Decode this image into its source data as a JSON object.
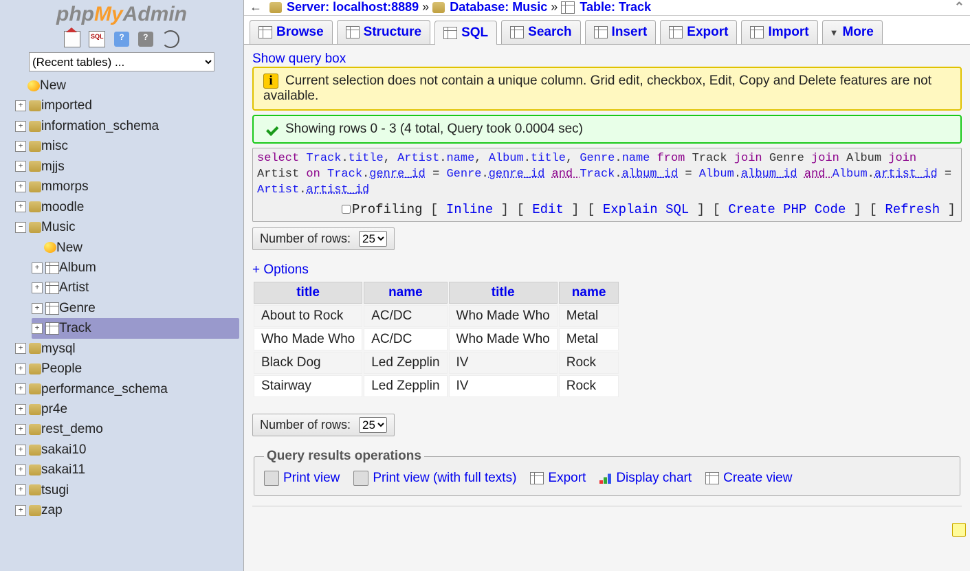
{
  "logo": {
    "php": "php",
    "my": "My",
    "admin": "Admin"
  },
  "sidebar": {
    "recent_placeholder": "(Recent tables) ...",
    "toolbar": [
      "home",
      "sql",
      "help",
      "talk",
      "reload"
    ],
    "new_label": "New",
    "dbs": [
      {
        "name": "imported",
        "expanded": false
      },
      {
        "name": "information_schema",
        "expanded": false
      },
      {
        "name": "misc",
        "expanded": false
      },
      {
        "name": "mjjs",
        "expanded": false
      },
      {
        "name": "mmorps",
        "expanded": false
      },
      {
        "name": "moodle",
        "expanded": false
      },
      {
        "name": "Music",
        "expanded": true,
        "tables": [
          {
            "name": "New",
            "new": true
          },
          {
            "name": "Album"
          },
          {
            "name": "Artist"
          },
          {
            "name": "Genre"
          },
          {
            "name": "Track",
            "selected": true
          }
        ]
      },
      {
        "name": "mysql",
        "expanded": false
      },
      {
        "name": "People",
        "expanded": false
      },
      {
        "name": "performance_schema",
        "expanded": false
      },
      {
        "name": "pr4e",
        "expanded": false
      },
      {
        "name": "rest_demo",
        "expanded": false
      },
      {
        "name": "sakai10",
        "expanded": false
      },
      {
        "name": "sakai11",
        "expanded": false
      },
      {
        "name": "tsugi",
        "expanded": false
      },
      {
        "name": "zap",
        "expanded": false
      }
    ]
  },
  "breadcrumb": {
    "server_label": "Server:",
    "server_value": "localhost:8889",
    "db_label": "Database:",
    "db_value": "Music",
    "table_label": "Table:",
    "table_value": "Track"
  },
  "tabs": [
    {
      "label": "Browse"
    },
    {
      "label": "Structure"
    },
    {
      "label": "SQL",
      "active": true
    },
    {
      "label": "Search"
    },
    {
      "label": "Insert"
    },
    {
      "label": "Export"
    },
    {
      "label": "Import"
    },
    {
      "label": "More",
      "chev": true
    }
  ],
  "show_query_box": "Show query box",
  "warning_text": "Current selection does not contain a unique column. Grid edit, checkbox, Edit, Copy and Delete features are not available.",
  "ok_text": "Showing rows 0 - 3 (4 total, Query took 0.0004 sec)",
  "sql_tokens": [
    {
      "t": "select ",
      "c": "kw"
    },
    {
      "t": "Track",
      "c": "id"
    },
    {
      "t": "."
    },
    {
      "t": "title",
      "c": "id"
    },
    {
      "t": ", "
    },
    {
      "t": "Artist",
      "c": "id"
    },
    {
      "t": "."
    },
    {
      "t": "name",
      "c": "id"
    },
    {
      "t": ", "
    },
    {
      "t": "Album",
      "c": "id"
    },
    {
      "t": "."
    },
    {
      "t": "title",
      "c": "id"
    },
    {
      "t": ", "
    },
    {
      "t": "Genre",
      "c": "id"
    },
    {
      "t": "."
    },
    {
      "t": "name",
      "c": "id"
    },
    {
      "t": " "
    },
    {
      "t": "from ",
      "c": "kw"
    },
    {
      "t": "Track "
    },
    {
      "t": "join ",
      "c": "kw"
    },
    {
      "t": "Genre "
    },
    {
      "t": "join ",
      "c": "kw"
    },
    {
      "t": "Album "
    },
    {
      "t": "join ",
      "c": "kw"
    },
    {
      "t": "Artist "
    },
    {
      "t": "on ",
      "c": "kw"
    },
    {
      "t": "Track",
      "c": "id"
    },
    {
      "t": "."
    },
    {
      "t": "genre_id",
      "c": "id underline"
    },
    {
      "t": " = "
    },
    {
      "t": "Genre",
      "c": "id"
    },
    {
      "t": "."
    },
    {
      "t": "genre_id",
      "c": "id underline"
    },
    {
      "t": " "
    },
    {
      "t": "and ",
      "c": "kw underline"
    },
    {
      "t": "Track",
      "c": "id"
    },
    {
      "t": "."
    },
    {
      "t": "album_id",
      "c": "id underline"
    },
    {
      "t": " = "
    },
    {
      "t": "Album",
      "c": "id"
    },
    {
      "t": "."
    },
    {
      "t": "album_id",
      "c": "id underline"
    },
    {
      "t": " "
    },
    {
      "t": "and ",
      "c": "kw underline"
    },
    {
      "t": "Album",
      "c": "id"
    },
    {
      "t": "."
    },
    {
      "t": "artist_id",
      "c": "id underline"
    },
    {
      "t": " = "
    },
    {
      "t": "Artist",
      "c": "id"
    },
    {
      "t": "."
    },
    {
      "t": "artist_id",
      "c": "id underline"
    }
  ],
  "sql_actions": {
    "profiling": "Profiling",
    "inline": "Inline",
    "edit": "Edit",
    "explain": "Explain SQL",
    "php": "Create PHP Code",
    "refresh": "Refresh"
  },
  "rows_label": "Number of rows:",
  "rows_value": "25",
  "options_link": "+ Options",
  "table": {
    "headers": [
      "title",
      "name",
      "title",
      "name"
    ],
    "rows": [
      [
        "About to Rock",
        "AC/DC",
        "Who Made Who",
        "Metal"
      ],
      [
        "Who Made Who",
        "AC/DC",
        "Who Made Who",
        "Metal"
      ],
      [
        "Black Dog",
        "Led Zepplin",
        "IV",
        "Rock"
      ],
      [
        "Stairway",
        "Led Zepplin",
        "IV",
        "Rock"
      ]
    ]
  },
  "ops": {
    "legend": "Query results operations",
    "print": "Print view",
    "print_full": "Print view (with full texts)",
    "export": "Export",
    "chart": "Display chart",
    "create_view": "Create view"
  },
  "chart_data": {
    "type": "table",
    "headers": [
      "title",
      "name",
      "title",
      "name"
    ],
    "rows": [
      [
        "About to Rock",
        "AC/DC",
        "Who Made Who",
        "Metal"
      ],
      [
        "Who Made Who",
        "AC/DC",
        "Who Made Who",
        "Metal"
      ],
      [
        "Black Dog",
        "Led Zepplin",
        "IV",
        "Rock"
      ],
      [
        "Stairway",
        "Led Zepplin",
        "IV",
        "Rock"
      ]
    ]
  }
}
